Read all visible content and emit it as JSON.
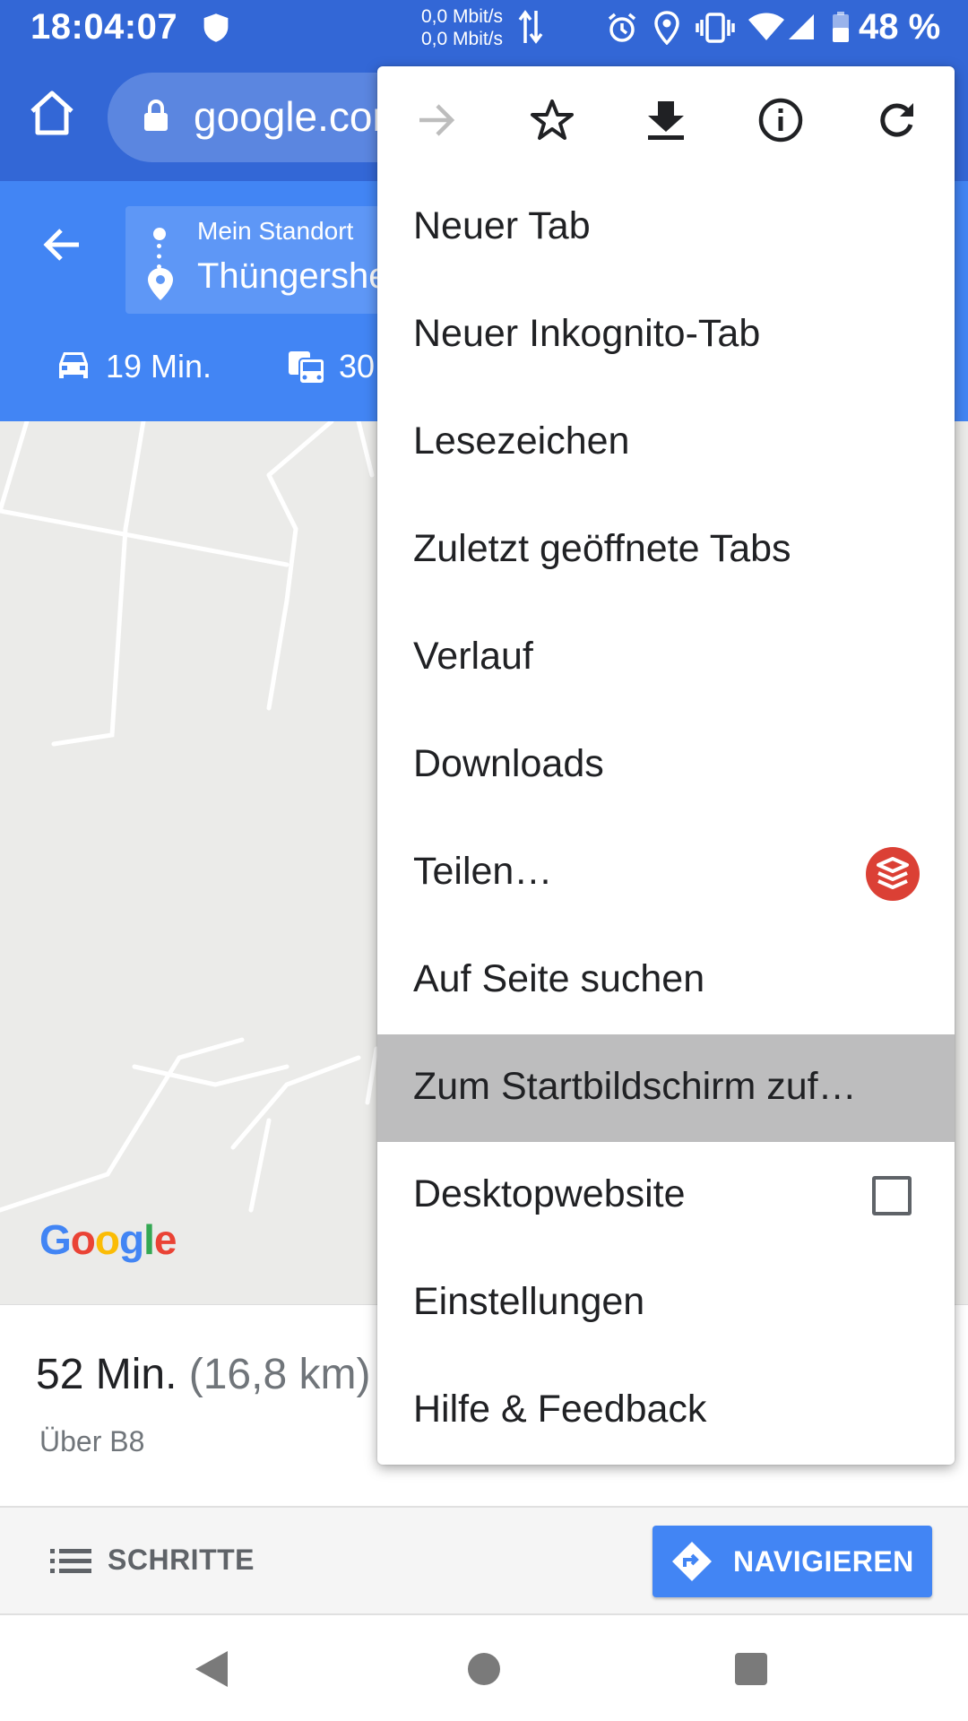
{
  "status_bar": {
    "time": "18:04:07",
    "net_up": "0,0 Mbit/s",
    "net_down": "0,0 Mbit/s",
    "battery": "48 %",
    "icons": [
      "shield-icon",
      "data-arrows-icon",
      "alarm-icon",
      "location-icon",
      "vibrate-icon",
      "wifi-icon",
      "signal-icon",
      "battery-icon"
    ]
  },
  "browser": {
    "url": "google.com"
  },
  "maps": {
    "origin": "Mein Standort",
    "destination": "Thüngersheim",
    "modes": [
      {
        "icon": "car-icon",
        "label": "19 Min."
      },
      {
        "icon": "transit-icon",
        "label": "30"
      }
    ],
    "logo": "Google",
    "logo_colors": [
      "#4285f4",
      "#ea4335",
      "#fbbc05",
      "#4285f4",
      "#34a853",
      "#ea4335"
    ],
    "route": {
      "duration": "52 Min.",
      "distance": "(16,8 km)",
      "via": "Über B8"
    },
    "steps_label": "SCHRITTE",
    "navigate_label": "NAVIGIEREN"
  },
  "menu": {
    "icon_row": [
      "forward-icon",
      "bookmark-star-icon",
      "download-icon",
      "info-icon",
      "reload-icon"
    ],
    "items": [
      {
        "label": "Neuer Tab"
      },
      {
        "label": "Neuer Inkognito-Tab"
      },
      {
        "label": "Lesezeichen"
      },
      {
        "label": "Zuletzt geöffnete Tabs"
      },
      {
        "label": "Verlauf"
      },
      {
        "label": "Downloads"
      },
      {
        "label": "Teilen…"
      },
      {
        "label": "Auf Seite suchen"
      },
      {
        "label": "Zum Startbildschirm zuf…"
      },
      {
        "label": "Desktopwebsite"
      },
      {
        "label": "Einstellungen"
      },
      {
        "label": "Hilfe & Feedback"
      }
    ],
    "highlighted": "Zum Startbildschirm zuf…",
    "colors": {
      "accent": "#4285f4",
      "toolbar": "#3367d6",
      "highlight": "#bdbdbe",
      "share_badge": "#db4035"
    }
  }
}
